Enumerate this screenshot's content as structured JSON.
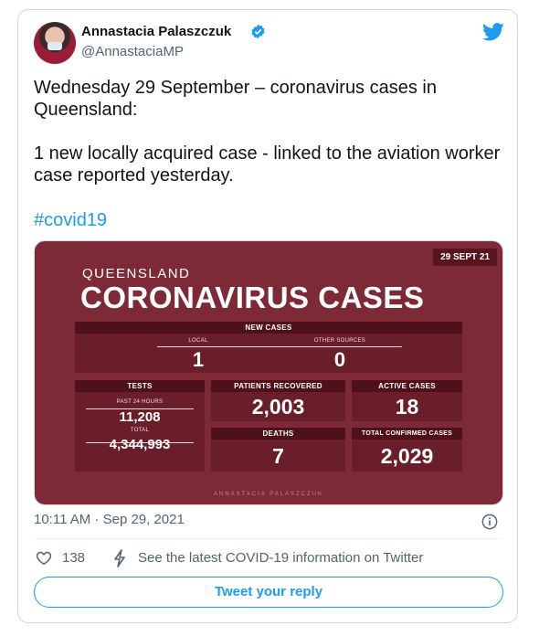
{
  "author": {
    "name": "Annastacia Palaszczuk",
    "handle": "@AnnastaciaMP",
    "verified": true,
    "avatar_icon": "profile-photo"
  },
  "tweet": {
    "text": "Wednesday 29 September – coronavirus cases in Queensland:\n\n1 new locally acquired case - linked to the aviation worker case reported yesterday.",
    "hashtag": "#covid19"
  },
  "media": {
    "date_tag": "29 SEPT 21",
    "region": "QUEENSLAND",
    "title": "CORONAVIRUS CASES",
    "new_cases": {
      "header": "NEW CASES",
      "local_label": "LOCAL",
      "local_value": "1",
      "other_label": "OTHER SOURCES",
      "other_value": "0"
    },
    "tests": {
      "header": "TESTS",
      "past24_label": "PAST 24 HOURS",
      "past24_value": "11,208",
      "total_label": "TOTAL",
      "total_value": "4,344,993"
    },
    "recovered": {
      "header": "PATIENTS RECOVERED",
      "value": "2,003"
    },
    "active": {
      "header": "ACTIVE CASES",
      "value": "18"
    },
    "deaths": {
      "header": "DEATHS",
      "value": "7"
    },
    "confirmed": {
      "header": "TOTAL CONFIRMED CASES",
      "value": "2,029"
    },
    "signature": "ANNASTACIA PALASZCZUK"
  },
  "meta": {
    "timestamp": "10:11 AM · Sep 29, 2021"
  },
  "actions": {
    "like_count": "138",
    "covid_link": "See the latest COVID-19 information on Twitter",
    "reply_button": "Tweet your reply"
  },
  "colors": {
    "accent": "#1d9bf0",
    "media_bg": "#7e2a36",
    "box_bg": "#6a1e2a",
    "box_header": "#4f1119"
  }
}
